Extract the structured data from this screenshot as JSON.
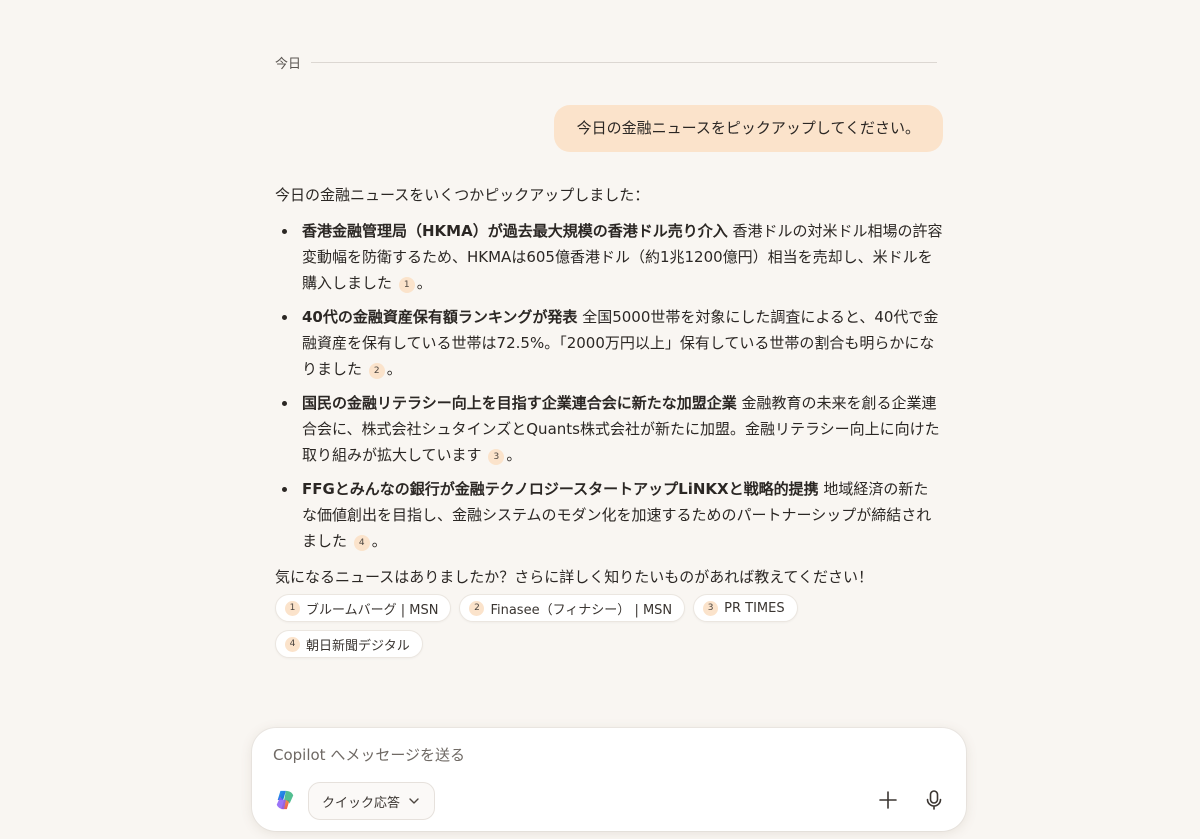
{
  "date_divider": "今日",
  "user_message": "今日の金融ニュースをピックアップしてください。",
  "reply": {
    "intro": "今日の金融ニュースをいくつかピックアップしました：",
    "items": [
      {
        "title": "香港金融管理局（HKMA）が過去最大規模の香港ドル売り介入",
        "body": " 香港ドルの対米ドル相場の許容変動幅を防衛するため、HKMAは605億香港ドル（約1兆1200億円）相当を売却し、米ドルを購入しました",
        "cite": "1"
      },
      {
        "title": "40代の金融資産保有額ランキングが発表",
        "body": " 全国5000世帯を対象にした調査によると、40代で金融資産を保有している世帯は72.5%。「2000万円以上」保有している世帯の割合も明らかになりました",
        "cite": "2"
      },
      {
        "title": "国民の金融リテラシー向上を目指す企業連合会に新たな加盟企業",
        "body": " 金融教育の未来を創る企業連合会に、株式会社シュタインズとQuants株式会社が新たに加盟。金融リテラシー向上に向けた取り組みが拡大しています",
        "cite": "3"
      },
      {
        "title": "FFGとみんなの銀行が金融テクノロジースタートアップLiNKXと戦略的提携",
        "body": " 地域経済の新たな価値創出を目指し、金融システムのモダン化を加速するためのパートナーシップが締結されました",
        "cite": "4"
      }
    ],
    "period": "。",
    "outro": "気になるニュースはありましたか？さらに詳しく知りたいものがあれば教えてください！"
  },
  "sources": [
    {
      "num": "1",
      "label": "ブルームバーグ | MSN"
    },
    {
      "num": "2",
      "label": "Finasee（フィナシー） | MSN"
    },
    {
      "num": "3",
      "label": "PR TIMES"
    },
    {
      "num": "4",
      "label": "朝日新聞デジタル"
    }
  ],
  "composer": {
    "placeholder": "Copilot へメッセージを送る",
    "quick_label": "クイック応答"
  },
  "icons": {
    "logo": "copilot-logo",
    "chevron": "chevron-down-icon",
    "plus": "plus-icon",
    "mic": "microphone-icon"
  },
  "colors": {
    "background": "#f9f6f2",
    "user_bubble": "#fbe3cb",
    "text": "#2b2724"
  }
}
